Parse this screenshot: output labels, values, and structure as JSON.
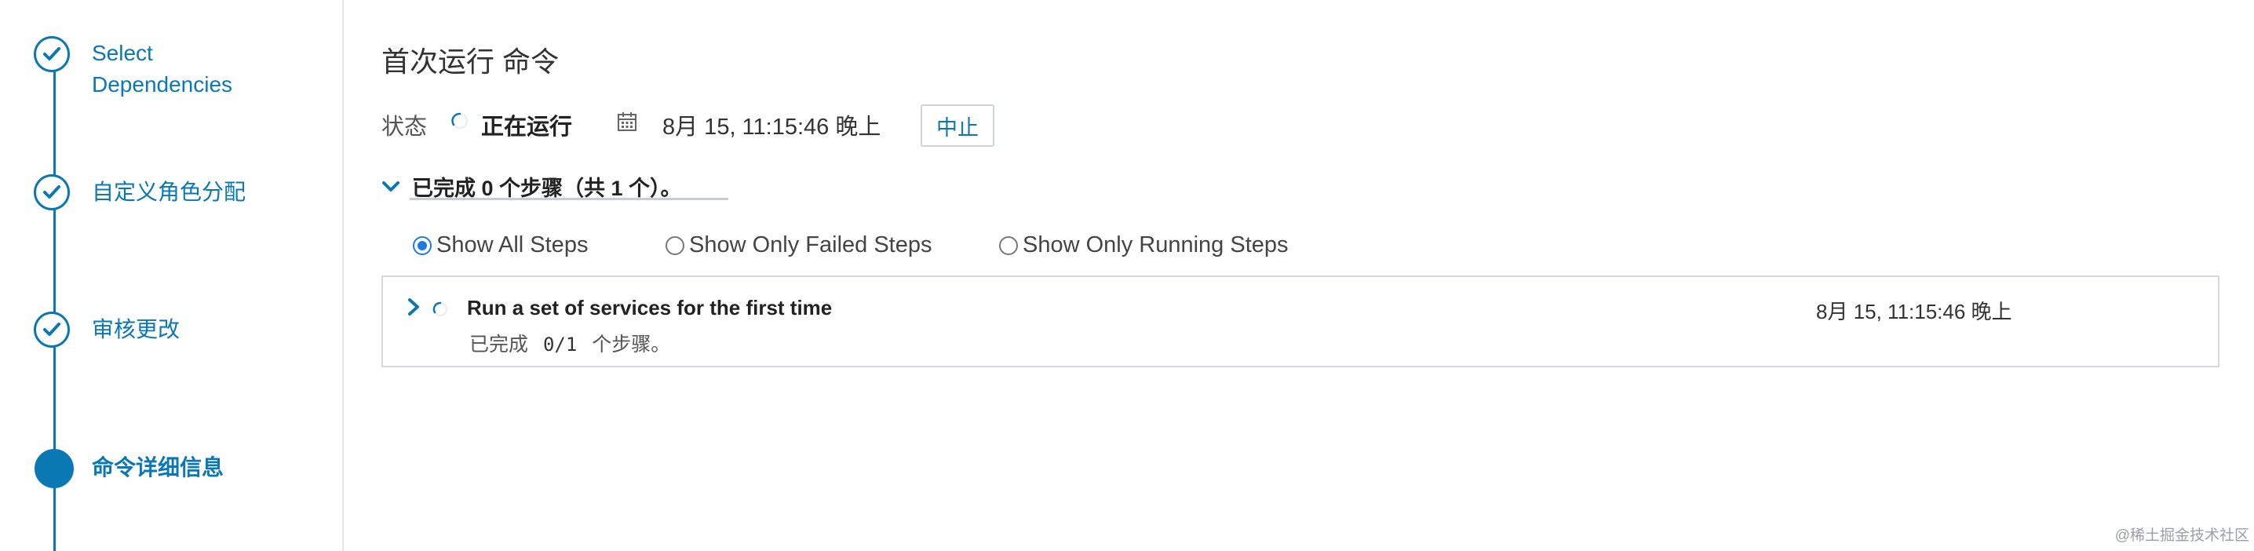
{
  "sidebar": {
    "steps": [
      {
        "label_line1": "Select",
        "label_line2": "Dependencies",
        "state": "done",
        "icon": "check-icon"
      },
      {
        "label": "自定义角色分配",
        "state": "done",
        "icon": "check-icon"
      },
      {
        "label": "审核更改",
        "state": "done",
        "icon": "check-icon"
      },
      {
        "label": "命令详细信息",
        "state": "active"
      }
    ]
  },
  "main": {
    "title": "首次运行 命令",
    "status_label": "状态",
    "status_value": "正在运行",
    "start_time": "8月 15, 11:15:46 晚上",
    "abort_label": "中止",
    "progress_summary": "已完成 0 个步骤（共 1 个）。",
    "filters": [
      {
        "label": "Show All Steps",
        "checked": true
      },
      {
        "label": "Show Only Failed Steps",
        "checked": false
      },
      {
        "label": "Show Only Running Steps",
        "checked": false
      }
    ],
    "command_steps": [
      {
        "title": "Run a set of services for the first time",
        "progress_prefix": "已完成",
        "progress_count": "0/1",
        "progress_suffix": "个步骤。",
        "time": "8月 15, 11:15:46 晚上"
      }
    ]
  },
  "watermark": "@稀土掘金技术社区",
  "colors": {
    "accent": "#0a78b3",
    "radio_checked": "#1d7be0",
    "border": "#d5d9dd"
  }
}
